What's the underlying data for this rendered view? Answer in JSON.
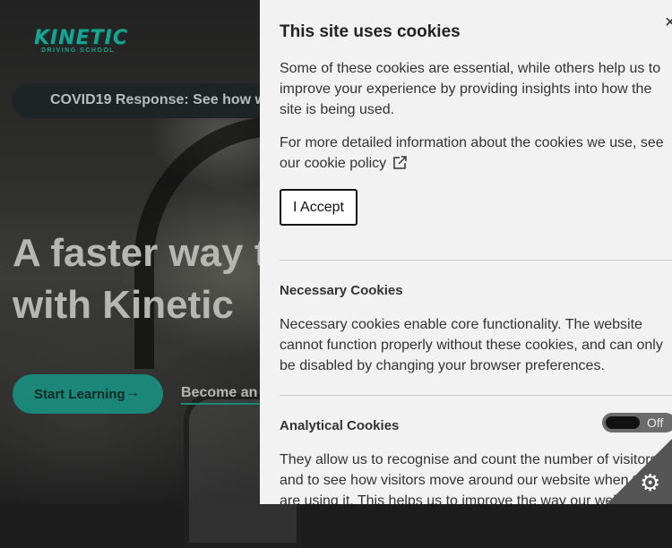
{
  "brand": {
    "logo_text": "KINETIC",
    "logo_subtext": "DRIVING SCHOOL",
    "accent_color": "#1aa391"
  },
  "hero": {
    "announcement": "COVID19 Response: See how we",
    "headline_line1": "A faster way t",
    "headline_line2": "with Kinetic",
    "start_button": "Start Learning",
    "start_arrow": "→",
    "become_link": "Become an i"
  },
  "cookie_panel": {
    "close_label": "×",
    "title": "This site uses cookies",
    "intro": "Some of these cookies are essential, while others help us to improve your experience by providing insights into how the site is being used.",
    "policy_text": "For more detailed information about the cookies we use, see our cookie policy",
    "accept_label": "I Accept",
    "necessary": {
      "title": "Necessary Cookies",
      "description": "Necessary cookies enable core functionality. The website cannot function properly without these cookies, and can only be disabled by changing your browser preferences."
    },
    "analytical": {
      "title": "Analytical Cookies",
      "toggle_state": "Off",
      "description": "They allow us to recognise and count the number of visitors and to see how visitors move around our website when they are using it. This helps us to improve the way our website works."
    },
    "settings_icon": "gear-icon"
  }
}
